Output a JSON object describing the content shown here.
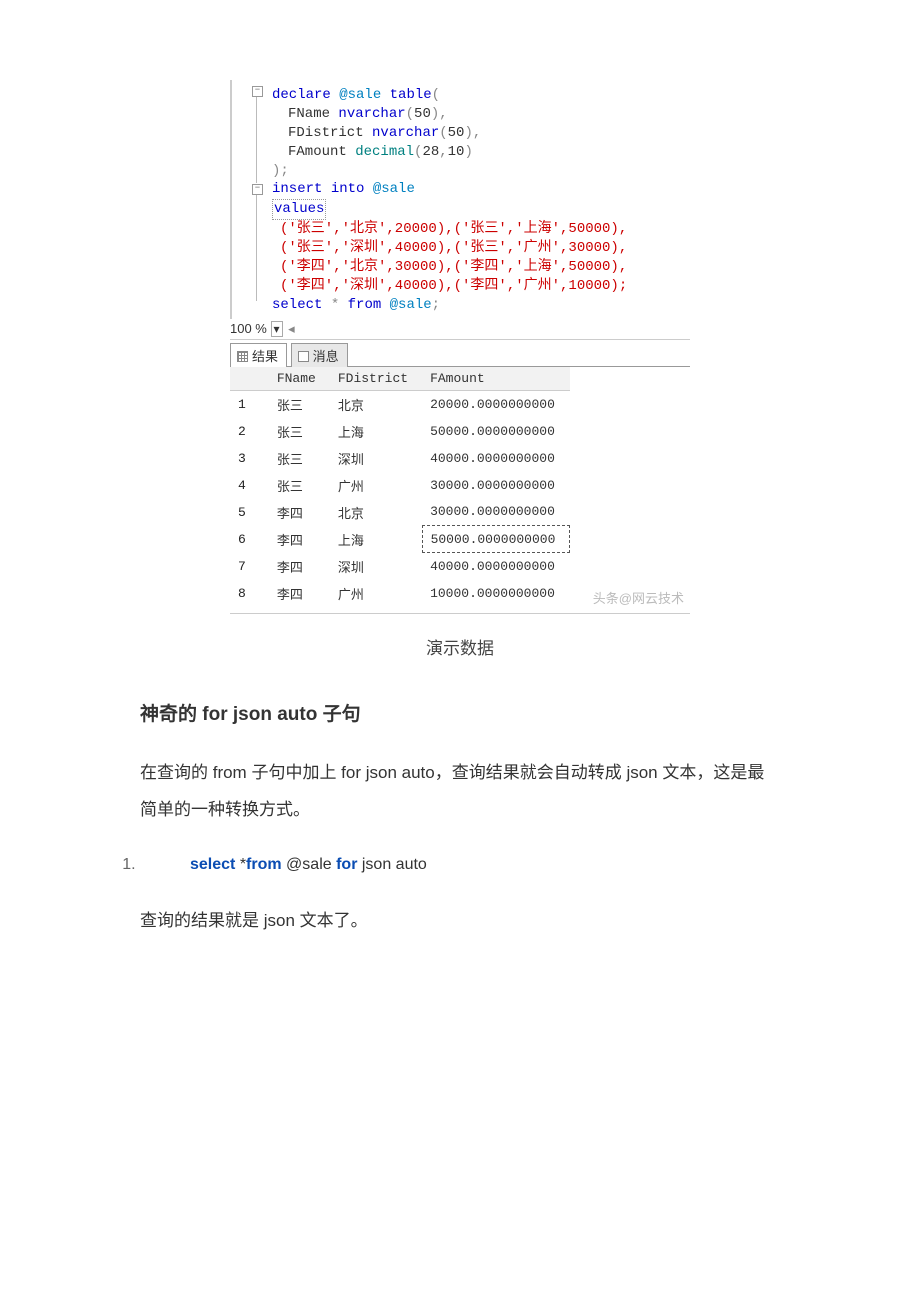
{
  "code": {
    "l1a": "declare",
    "l1b": "@sale",
    "l1c": "table",
    "l1d": "(",
    "l2a": "FName",
    "l2b": "nvarchar",
    "l2c": "(",
    "l2d": "50",
    "l2e": "),",
    "l3a": "FDistrict",
    "l3b": "nvarchar",
    "l3c": "(",
    "l3d": "50",
    "l3e": "),",
    "l4a": "FAmount",
    "l4b": "decimal",
    "l4c": "(",
    "l4d": "28",
    "l4e": ",",
    "l4f": "10",
    "l4g": ")",
    "l5": ");",
    "l6a": "insert",
    "l6b": "into",
    "l6c": "@sale",
    "l7": "values",
    "r1": "('张三','北京',20000),('张三','上海',50000),",
    "r2": "('张三','深圳',40000),('张三','广州',30000),",
    "r3": "('李四','北京',30000),('李四','上海',50000),",
    "r4": "('李四','深圳',40000),('李四','广州',10000);",
    "s1a": "select",
    "s1b": "*",
    "s1c": "from",
    "s1d": "@sale",
    "s1e": ";"
  },
  "zoom": "100 %",
  "tabs": {
    "results": "结果",
    "messages": "消息"
  },
  "grid": {
    "headers": {
      "blank": "",
      "fname": "FName",
      "fdistrict": "FDistrict",
      "famount": "FAmount"
    },
    "rows": [
      {
        "i": "1",
        "n": "张三",
        "d": "北京",
        "a": "20000.0000000000"
      },
      {
        "i": "2",
        "n": "张三",
        "d": "上海",
        "a": "50000.0000000000"
      },
      {
        "i": "3",
        "n": "张三",
        "d": "深圳",
        "a": "40000.0000000000"
      },
      {
        "i": "4",
        "n": "张三",
        "d": "广州",
        "a": "30000.0000000000"
      },
      {
        "i": "5",
        "n": "李四",
        "d": "北京",
        "a": "30000.0000000000"
      },
      {
        "i": "6",
        "n": "李四",
        "d": "上海",
        "a": "50000.0000000000"
      },
      {
        "i": "7",
        "n": "李四",
        "d": "深圳",
        "a": "40000.0000000000"
      },
      {
        "i": "8",
        "n": "李四",
        "d": "广州",
        "a": "10000.0000000000"
      }
    ]
  },
  "watermark": "头条@网云技术",
  "caption": "演示数据",
  "article": {
    "h3": "神奇的 for json auto 子句",
    "p1": "在查询的 from 子句中加上  for json auto，查询结果就会自动转成 json 文本，这是最简单的一种转换方式。",
    "codeline": {
      "t1": "select",
      "t2": " *",
      "t3": "from",
      "t4": " @sale ",
      "t5": "for",
      "t6": " json auto"
    },
    "p2": "查询的结果就是 json 文本了。"
  }
}
